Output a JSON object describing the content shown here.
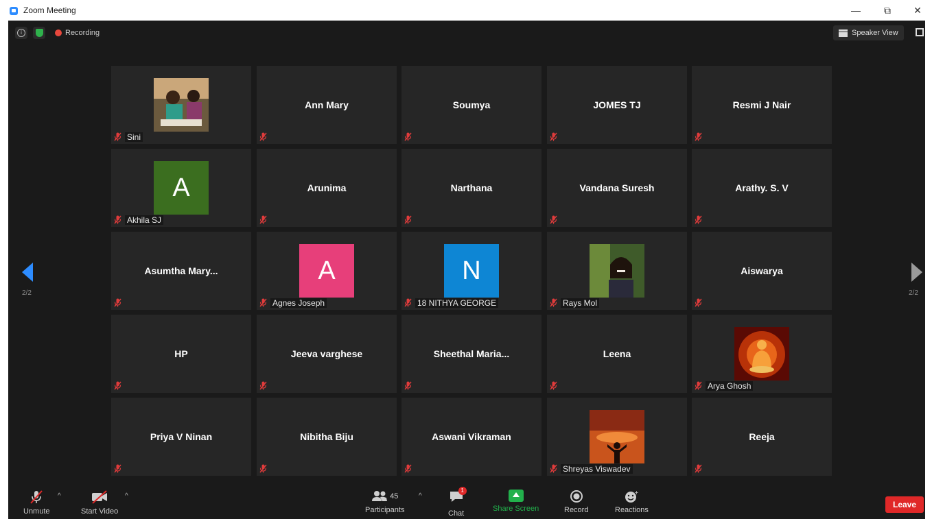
{
  "window": {
    "title": "Zoom Meeting",
    "minimize": "—",
    "restore": "⧉",
    "close": "✕"
  },
  "meeting": {
    "recording_label": "Recording",
    "speaker_view_label": "Speaker View",
    "page_indicator": "2/2"
  },
  "tiles": [
    {
      "name": "Sini",
      "type": "photo",
      "photo": "people-icon"
    },
    {
      "name": "Ann Mary",
      "type": "name"
    },
    {
      "name": "Soumya",
      "type": "name"
    },
    {
      "name": "JOMES TJ",
      "type": "name"
    },
    {
      "name": "Resmi J Nair",
      "type": "name"
    },
    {
      "name": "Akhila SJ",
      "type": "letter",
      "letter": "A",
      "color": "#3b6e1f"
    },
    {
      "name": "Arunima",
      "type": "name"
    },
    {
      "name": "Narthana",
      "type": "name"
    },
    {
      "name": "Vandana Suresh",
      "type": "name"
    },
    {
      "name": "Arathy. S. V",
      "type": "name"
    },
    {
      "name": "Asumtha Mary...",
      "type": "name"
    },
    {
      "name": "Agnes Joseph",
      "type": "letter",
      "letter": "A",
      "color": "#e73f7a"
    },
    {
      "name": "18 NITHYA GEORGE",
      "type": "letter",
      "letter": "N",
      "color": "#0e86d4"
    },
    {
      "name": "Rays Mol",
      "type": "photo",
      "photo": "portrait-icon"
    },
    {
      "name": "Aiswarya",
      "type": "name"
    },
    {
      "name": "HP",
      "type": "name"
    },
    {
      "name": "Jeeva varghese",
      "type": "name"
    },
    {
      "name": "Sheethal  Maria...",
      "type": "name"
    },
    {
      "name": "Leena",
      "type": "name"
    },
    {
      "name": "Arya Ghosh",
      "type": "photo",
      "photo": "buddha-icon"
    },
    {
      "name": "Priya V Ninan",
      "type": "name"
    },
    {
      "name": "Nibitha Biju",
      "type": "name"
    },
    {
      "name": "Aswani Vikraman",
      "type": "name"
    },
    {
      "name": "Shreyas Viswadev",
      "type": "photo",
      "photo": "sunset-icon"
    },
    {
      "name": "Reeja",
      "type": "name"
    }
  ],
  "toolbar": {
    "unmute": "Unmute",
    "start_video": "Start Video",
    "participants": "Participants",
    "participants_count": "45",
    "chat": "Chat",
    "chat_badge": "1",
    "share_screen": "Share Screen",
    "record": "Record",
    "reactions": "Reactions",
    "leave": "Leave"
  }
}
